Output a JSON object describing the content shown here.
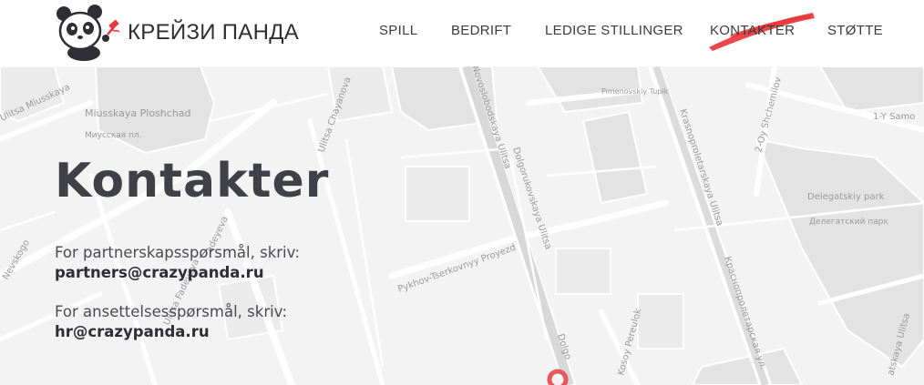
{
  "header": {
    "brand": "КРЕЙЗИ ПАНДА",
    "nav": [
      {
        "label": "SPILL"
      },
      {
        "label": "BEDRIFT"
      },
      {
        "label": "LEDIGE STILLINGER"
      },
      {
        "label": "KONTAKTER",
        "active": true
      },
      {
        "label": "STØTTE"
      }
    ],
    "accent_color": "#e8383b"
  },
  "main": {
    "title": "Kontakter",
    "partners_label": "For partnerskapsspørsmål, skriv:",
    "partners_email": "partners@crazypanda.ru",
    "hr_label": "For ansettelsesspørsmål, skriv:",
    "hr_email": "hr@crazypanda.ru"
  },
  "map": {
    "labels": {
      "miusskaya": "Miusskaya Ploshchad",
      "miusskaya_ru": "Миусская пл.",
      "miusskaya_street": "Ulitsa Miusskaya",
      "chayanova": "Ulitsa Chayanova",
      "nevskogo": "Nevskogo",
      "adeyeva": "adeyeva",
      "ulitsa_fadeyeva": "Ulitsa Fadeyeva",
      "novoslobodskaya": "Novoslobodskaya Ulitsa",
      "dolgorukovskaya": "Dolgorukovskaya Ulitsa",
      "pimenovskiy": "Pimenovskiy Tupik",
      "krasnoproletarskaya": "Krasnoproletarskaya Ulitsa",
      "krasnoproletarskaya_ru": "Краснопролетарская ул.",
      "shchemilov": "2-Oy Shchemilov",
      "samotechny": "1-Y Samo",
      "delegatskiy": "Delegatskiy park",
      "delegatskiy_ru": "Делегатский парк",
      "pykhov": "Pykhov-Tserkovnyy Proyezd",
      "kosoy": "Kosoy Pereulok",
      "dolgo": "Dolgo",
      "delegatskaya": "atskaya Ulitsa"
    },
    "marker_color": "#e8585b"
  }
}
